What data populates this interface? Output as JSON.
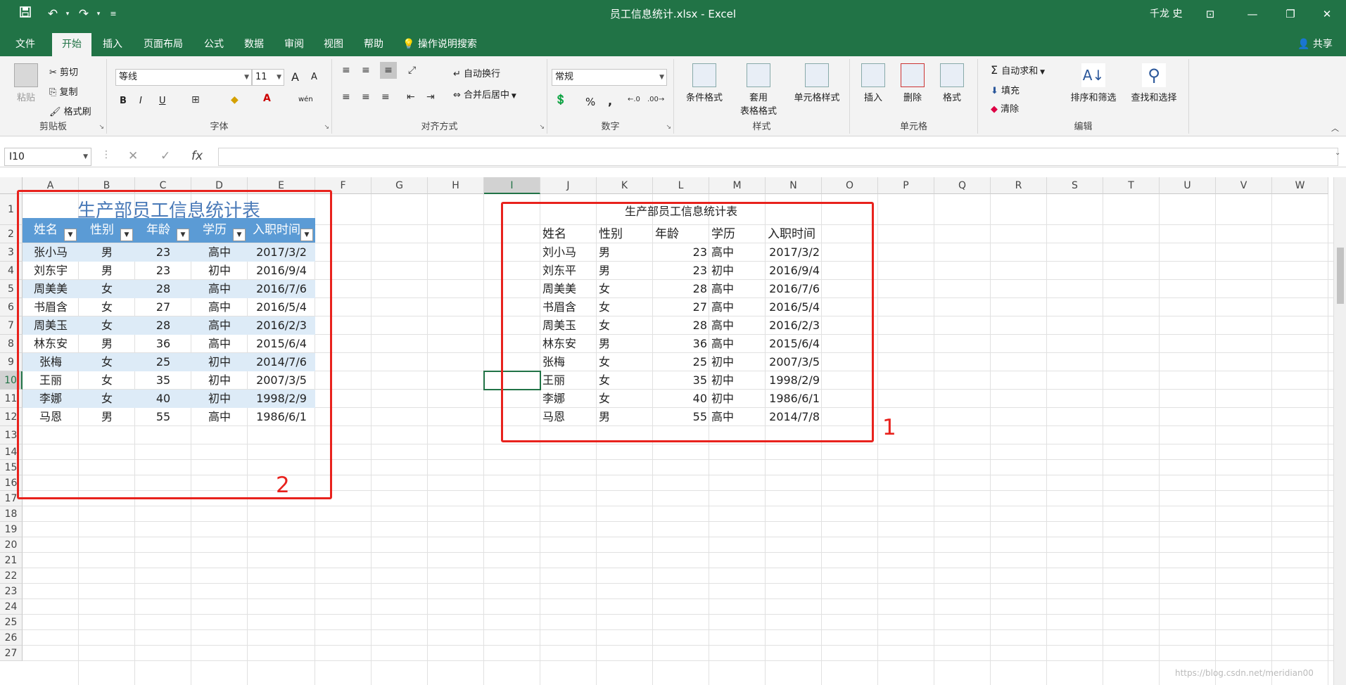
{
  "window": {
    "title": "员工信息统计.xlsx  -  Excel",
    "user": "千龙 史",
    "save_icon": "save-icon",
    "undo_icon": "undo-icon",
    "redo_icon": "redo-icon"
  },
  "menu": {
    "tabs": [
      "文件",
      "开始",
      "插入",
      "页面布局",
      "公式",
      "数据",
      "审阅",
      "视图",
      "帮助"
    ],
    "active_tab": "开始",
    "tell_me": "操作说明搜索",
    "share": "共享"
  },
  "ribbon": {
    "clipboard": {
      "paste": "粘贴",
      "cut": "剪切",
      "copy": "复制",
      "format_painter": "格式刷",
      "label": "剪贴板"
    },
    "font": {
      "font_name": "等线",
      "font_size": "11",
      "bold": "B",
      "italic": "I",
      "underline": "U",
      "grow": "A",
      "shrink": "A",
      "wen": "wén",
      "label": "字体"
    },
    "alignment": {
      "wrap": "自动换行",
      "merge": "合并后居中",
      "label": "对齐方式"
    },
    "number": {
      "format": "常规",
      "percent": "%",
      "comma": ",",
      "label": "数字"
    },
    "styles": {
      "conditional": "条件格式",
      "table_format_1": "套用",
      "table_format_2": "表格格式",
      "cell_styles": "单元格样式",
      "label": "样式"
    },
    "cells": {
      "insert": "插入",
      "delete": "删除",
      "format": "格式",
      "label": "单元格"
    },
    "editing": {
      "autosum": "自动求和",
      "fill": "填充",
      "clear": "清除",
      "sort": "排序和筛选",
      "find": "查找和选择",
      "label": "编辑"
    }
  },
  "formula_bar": {
    "name_box": "I10",
    "cancel": "✕",
    "confirm": "✓",
    "fx": "fx",
    "formula": ""
  },
  "grid": {
    "columns": [
      "A",
      "B",
      "C",
      "D",
      "E",
      "F",
      "G",
      "H",
      "I",
      "J",
      "K",
      "L",
      "M",
      "N",
      "O",
      "P",
      "Q",
      "R",
      "S",
      "T",
      "U",
      "V",
      "W"
    ],
    "rows": [
      "1",
      "2",
      "3",
      "4",
      "5",
      "6",
      "7",
      "8",
      "9",
      "10",
      "11",
      "12",
      "13",
      "14",
      "15",
      "16",
      "17",
      "18",
      "19",
      "20",
      "21",
      "22",
      "23",
      "24",
      "25",
      "26",
      "27"
    ],
    "selected_column": "I",
    "selected_row": "10"
  },
  "table_left": {
    "title": "生产部员工信息统计表",
    "headers": [
      "姓名",
      "性别",
      "年龄",
      "学历",
      "入职时间"
    ],
    "rows": [
      [
        "张小马",
        "男",
        "23",
        "高中",
        "2017/3/2"
      ],
      [
        "刘东宇",
        "男",
        "23",
        "初中",
        "2016/9/4"
      ],
      [
        "周美美",
        "女",
        "28",
        "高中",
        "2016/7/6"
      ],
      [
        "书眉含",
        "女",
        "27",
        "高中",
        "2016/5/4"
      ],
      [
        "周美玉",
        "女",
        "28",
        "高中",
        "2016/2/3"
      ],
      [
        "林东安",
        "男",
        "36",
        "高中",
        "2015/6/4"
      ],
      [
        "张梅",
        "女",
        "25",
        "初中",
        "2014/7/6"
      ],
      [
        "王丽",
        "女",
        "35",
        "初中",
        "2007/3/5"
      ],
      [
        "李娜",
        "女",
        "40",
        "初中",
        "1998/2/9"
      ],
      [
        "马恩",
        "男",
        "55",
        "高中",
        "1986/6/1"
      ]
    ],
    "annotation": "2"
  },
  "table_right": {
    "title": "生产部员工信息统计表",
    "headers": [
      "姓名",
      "性别",
      "年龄",
      "学历",
      "入职时间"
    ],
    "rows": [
      [
        "刘小马",
        "男",
        "23",
        "高中",
        "2017/3/2"
      ],
      [
        "刘东平",
        "男",
        "23",
        "初中",
        "2016/9/4"
      ],
      [
        "周美美",
        "女",
        "28",
        "高中",
        "2016/7/6"
      ],
      [
        "书眉含",
        "女",
        "27",
        "高中",
        "2016/5/4"
      ],
      [
        "周美玉",
        "女",
        "28",
        "高中",
        "2016/2/3"
      ],
      [
        "林东安",
        "男",
        "36",
        "高中",
        "2015/6/4"
      ],
      [
        "张梅",
        "女",
        "25",
        "初中",
        "2007/3/5"
      ],
      [
        "王丽",
        "女",
        "35",
        "初中",
        "1998/2/9"
      ],
      [
        "李娜",
        "女",
        "40",
        "初中",
        "1986/6/1"
      ],
      [
        "马恩",
        "男",
        "55",
        "高中",
        "2014/7/8"
      ]
    ],
    "annotation": "1"
  },
  "watermark": "https://blog.csdn.net/meridian00"
}
